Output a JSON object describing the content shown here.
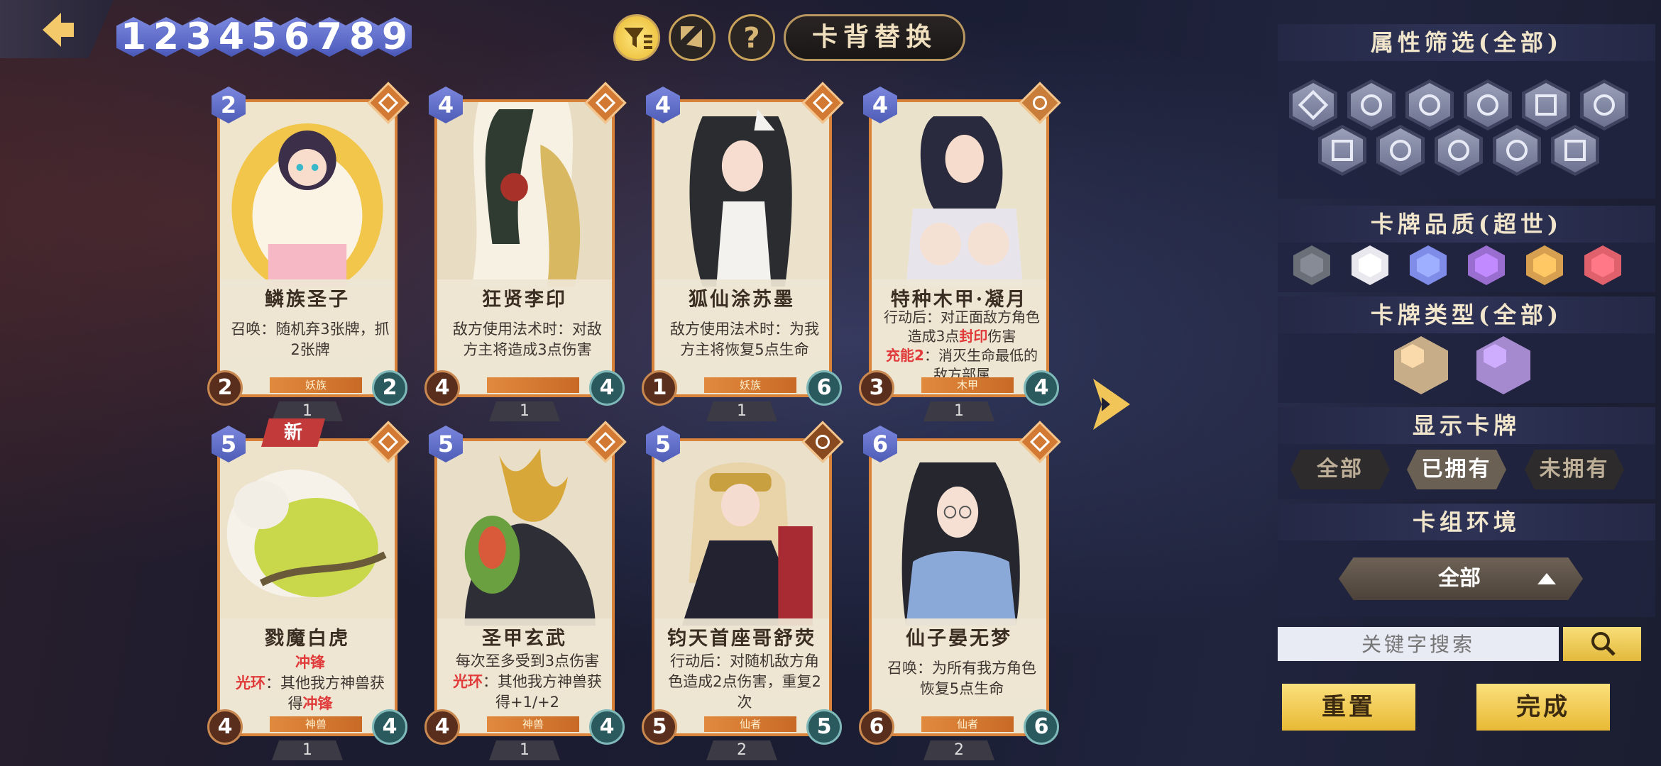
{
  "top_bar": {
    "cost_filters": [
      "1",
      "2",
      "3",
      "4",
      "5",
      "6",
      "7",
      "8",
      "9"
    ],
    "cardback_label": "卡背替换"
  },
  "cards": [
    {
      "cost": "2",
      "name": "鳞族圣子",
      "desc": "召唤：随机弃3张牌，抓2张牌",
      "tribe": "妖族",
      "atk": "2",
      "hp": "2",
      "count": "1"
    },
    {
      "cost": "4",
      "name": "狂贤李印",
      "desc": "敌方使用法术时：对敌方主将造成3点伤害",
      "tribe": "",
      "atk": "4",
      "hp": "4",
      "count": "1"
    },
    {
      "cost": "4",
      "name": "狐仙涂苏墨",
      "desc": "敌方使用法术时：为我方主将恢复5点生命",
      "tribe": "妖族",
      "atk": "1",
      "hp": "6",
      "count": "1"
    },
    {
      "cost": "4",
      "name": "特种木甲·凝月",
      "desc_a": "行动后：对正面敌方角色造成3点",
      "desc_red": "封印",
      "desc_b": "伤害",
      "desc_red2": "充能2",
      "desc_c": "：消灭生命最低的敌方部属",
      "tribe": "木甲",
      "atk": "3",
      "hp": "4",
      "count": "1"
    },
    {
      "cost": "5",
      "name": "戮魔白虎",
      "new_tag": "新",
      "kw1": "冲锋",
      "kw2": "光环",
      "desc_b": "：其他我方神兽获得",
      "kw3": "冲锋",
      "tribe": "神兽",
      "atk": "4",
      "hp": "4",
      "count": "1"
    },
    {
      "cost": "5",
      "name": "圣甲玄武",
      "desc_a": "每次至多受到3点伤害",
      "kw2": "光环",
      "desc_b": "：其他我方神兽获得+1/+2",
      "tribe": "神兽",
      "atk": "4",
      "hp": "4",
      "count": "1"
    },
    {
      "cost": "5",
      "name": "钧天首座哥舒荧",
      "desc": "行动后：对随机敌方角色造成2点伤害，重复2次",
      "tribe": "仙者",
      "atk": "5",
      "hp": "5",
      "count": "2"
    },
    {
      "cost": "6",
      "name": "仙子晏无梦",
      "desc": "召唤：为所有我方角色恢复5点生命",
      "tribe": "仙者",
      "atk": "6",
      "hp": "6",
      "count": "2"
    }
  ],
  "panel": {
    "attr_title": "属性筛选(全部)",
    "quality_title": "卡牌品质(超世)",
    "type_title": "卡牌类型(全部)",
    "show_title": "显示卡牌",
    "show_options": [
      "全部",
      "已拥有",
      "未拥有"
    ],
    "deck_title": "卡组环境",
    "deck_value": "全部",
    "search_placeholder": "关键字搜索",
    "reset_label": "重置",
    "done_label": "完成",
    "quality_colors": [
      "#6b6f78",
      "#e8e8ee",
      "#7f8ce8",
      "#9a6ed0",
      "#d6a050",
      "#e0606c"
    ]
  }
}
